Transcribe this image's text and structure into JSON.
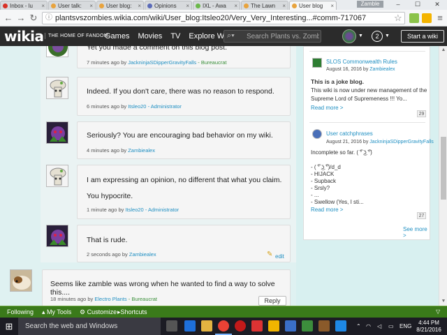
{
  "browser": {
    "tabs": [
      {
        "label": "Inbox - lu",
        "color": "#d93025"
      },
      {
        "label": "User talk:",
        "color": "#e8a33d"
      },
      {
        "label": "User blog:",
        "color": "#e8a33d"
      },
      {
        "label": "Opinions",
        "color": "#5b6bb8"
      },
      {
        "label": "IXL - Awa",
        "color": "#6bb84a"
      },
      {
        "label": "The Lawn",
        "color": "#e8a33d"
      },
      {
        "label": "User blog",
        "color": "#e8a33d"
      }
    ],
    "profile_name": "Zamble",
    "url": "plantsvszombies.wikia.com/wiki/User_blog:Itsleo20/Very_Very_Interesting...#comm-717067"
  },
  "wikia": {
    "logo": "wikia",
    "home_of_fandom": "THE HOME OF FANDOM",
    "nav": [
      "Games",
      "Movies",
      "TV",
      "Explore Wikia ▾"
    ],
    "search_placeholder": "Search Plants vs. Zombi",
    "notif_count": "2",
    "start_wiki": "Start a wiki"
  },
  "comments": [
    {
      "text": "Yet you made a comment on this blog post.",
      "time": "7 minutes ago by ",
      "author": "JackninjaSDipperGravityFalls",
      "role": " - Bureaucrat"
    },
    {
      "text": "Indeed. If you don't care, there was no reason to respond.",
      "time": "6 minutes ago by ",
      "author": "Itsleo20",
      "role": " - Administrator"
    },
    {
      "text": "Seriously? You are encouraging bad behavior on my wiki.",
      "time": "4 minutes ago by ",
      "author": "Zambiealex",
      "role": ""
    },
    {
      "text": "I am expressing an opinion, no different that what you claim.",
      "text2": "You hypocrite.",
      "time": "1 minute ago by ",
      "author": "Itsleo20",
      "role": " - Administrator"
    },
    {
      "text": "That is rude.",
      "time": "2 seconds ago by ",
      "author": "Zambiealex",
      "role": "",
      "edit": "edit"
    },
    {
      "text": "Seems like zamble was wrong when he wanted to find a way to solve this....",
      "time": "18 minutes ago by ",
      "author": "Electro Plants",
      "role": " - Bureaucrat",
      "reply": "Reply"
    }
  ],
  "sidebar": {
    "item1": {
      "title": "SLOS Commonwealth Rules",
      "date": "August 16, 2016 by ",
      "author": "Zambiealex",
      "bold": "This is a joke blog.",
      "body": "This wiki is now under new management of the Supreme Lord of Supremeness !!! Yo...",
      "read_more": "Read more >",
      "count": "29"
    },
    "item2": {
      "title": "User catchphrases",
      "date": "August 21, 2016 by ",
      "author": "JackninjaSDipperGravityFalls",
      "intro": "Incomplete so far. ( ͡° ͜ʖ ͡°)",
      "lines": [
        "- ( ͡° ͜ʖ ͡°)/d_d",
        "- HIJACK",
        "- Supback",
        "- Srsly?",
        "- ...",
        "- Swellow (Yes, I sti..."
      ],
      "read_more": "Read more >",
      "count": "27"
    },
    "see_more": "See more >"
  },
  "toolbar": {
    "following": "Following",
    "my_tools": "▴ My Tools",
    "customize": "⚙ Customize",
    "shortcuts": "▸Shortcuts"
  },
  "taskbar": {
    "search": "Search the web and Windows",
    "lang": "ENG",
    "time": "4:44 PM",
    "date": "8/21/2016"
  }
}
